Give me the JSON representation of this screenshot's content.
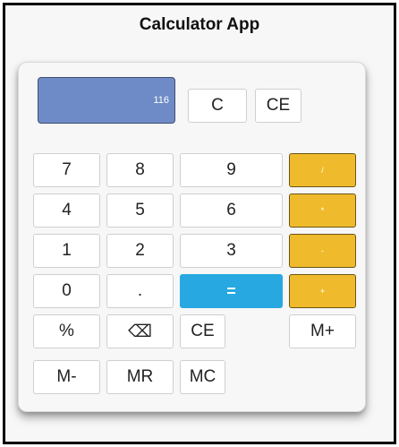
{
  "app": {
    "title": "Calculator App"
  },
  "display": {
    "value": "116"
  },
  "top_buttons": {
    "clear": "C",
    "clear_entry": "CE"
  },
  "keys": {
    "seven": "7",
    "eight": "8",
    "nine": "9",
    "four": "4",
    "five": "5",
    "six": "6",
    "one": "1",
    "two": "2",
    "three": "3",
    "zero": "0",
    "decimal": ".",
    "equals": "=",
    "percent": "%",
    "backspace": "⌫",
    "clear_entry": "CE",
    "memory_add": "M+",
    "memory_subtract": "M-",
    "memory_recall": "MR",
    "memory_clear": "MC"
  },
  "operators": {
    "divide": "/",
    "multiply": "*",
    "subtract": "-",
    "add": "+"
  },
  "colors": {
    "display_bg": "#6f8bc7",
    "operator_bg": "#efbb2c",
    "equals_bg": "#27a8e0",
    "button_bg": "#ffffff"
  }
}
